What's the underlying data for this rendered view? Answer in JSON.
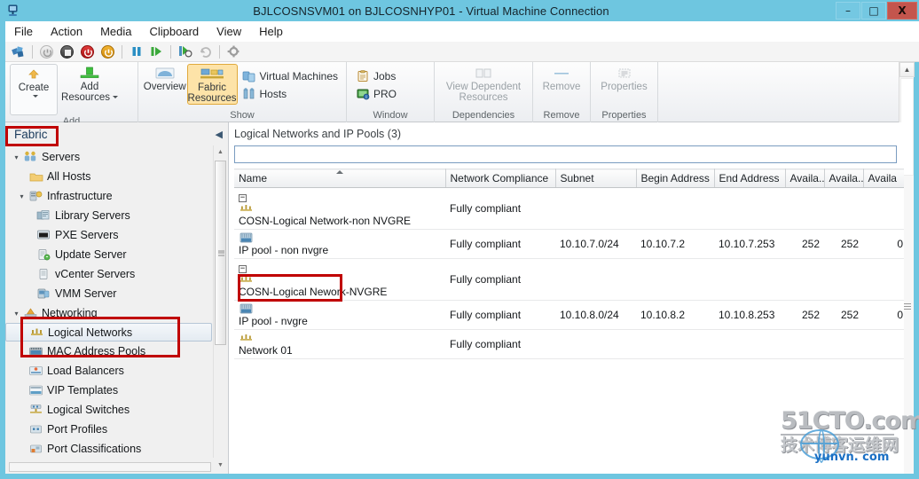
{
  "window": {
    "title": "BJLCOSNSVM01 on BJLCOSNHYP01 - Virtual Machine Connection",
    "app_icon": "virtual-machine-icon",
    "minimize": "–",
    "maximize": "□",
    "close": "X"
  },
  "menubar": {
    "items": [
      {
        "label": "File"
      },
      {
        "label": "Action"
      },
      {
        "label": "Media"
      },
      {
        "label": "Clipboard"
      },
      {
        "label": "View"
      },
      {
        "label": "Help"
      }
    ]
  },
  "vm_toolbar": {
    "buttons": [
      {
        "name": "ctrl-alt-delete-icon"
      },
      {
        "name": "start-icon"
      },
      {
        "name": "turn-off-icon"
      },
      {
        "name": "shut-down-icon"
      },
      {
        "name": "reset-icon"
      },
      {
        "name": "pause-icon"
      },
      {
        "name": "resume-icon"
      },
      {
        "name": "snapshot-icon"
      },
      {
        "name": "revert-icon"
      },
      {
        "name": "settings-icon"
      }
    ]
  },
  "ribbon": {
    "groups": [
      {
        "label": "Add",
        "buttons": [
          {
            "label_line1": "Create",
            "label_line2": "",
            "icon": "create-icon",
            "has_dropdown": true,
            "selected": false,
            "disabled": false
          },
          {
            "label_line1": "Add",
            "label_line2": "Resources",
            "icon": "add-resources-icon",
            "has_dropdown": true,
            "selected": false,
            "disabled": false
          }
        ]
      },
      {
        "label": "Show",
        "buttons": [
          {
            "label_line1": "Overview",
            "label_line2": "",
            "icon": "overview-icon",
            "has_dropdown": false,
            "selected": false,
            "disabled": false
          },
          {
            "label_line1": "Fabric",
            "label_line2": "Resources",
            "icon": "fabric-resources-icon",
            "has_dropdown": false,
            "selected": true,
            "disabled": false
          }
        ],
        "small_buttons": [
          {
            "label": "Virtual Machines",
            "icon": "virtual-machines-icon"
          },
          {
            "label": "Hosts",
            "icon": "hosts-icon"
          }
        ]
      },
      {
        "label": "Window",
        "small_buttons": [
          {
            "label": "Jobs",
            "icon": "jobs-icon"
          },
          {
            "label": "PRO",
            "icon": "pro-icon"
          }
        ]
      },
      {
        "label": "Dependencies",
        "buttons": [
          {
            "label_line1": "View Dependent",
            "label_line2": "Resources",
            "icon": "view-dependent-resources-icon",
            "has_dropdown": false,
            "selected": false,
            "disabled": true
          }
        ]
      },
      {
        "label": "Remove",
        "buttons": [
          {
            "label_line1": "Remove",
            "label_line2": "",
            "icon": "remove-icon",
            "has_dropdown": false,
            "selected": false,
            "disabled": true
          }
        ]
      },
      {
        "label": "Properties",
        "buttons": [
          {
            "label_line1": "Properties",
            "label_line2": "",
            "icon": "properties-icon",
            "has_dropdown": false,
            "selected": false,
            "disabled": true
          }
        ]
      }
    ]
  },
  "left_pane": {
    "title": "Fabric",
    "collapse_icon": "◀",
    "tree": [
      {
        "label": "Servers",
        "icon": "servers-icon",
        "depth": 0,
        "twisty": "expanded",
        "selected": false
      },
      {
        "label": "All Hosts",
        "icon": "folder-icon",
        "depth": 1,
        "twisty": "none",
        "selected": false
      },
      {
        "label": "Infrastructure",
        "icon": "infrastructure-icon",
        "depth": 1,
        "twisty": "expanded",
        "selected": false
      },
      {
        "label": "Library Servers",
        "icon": "library-servers-icon",
        "depth": 2,
        "twisty": "none",
        "selected": false
      },
      {
        "label": "PXE Servers",
        "icon": "pxe-servers-icon",
        "depth": 2,
        "twisty": "none",
        "selected": false
      },
      {
        "label": "Update Server",
        "icon": "update-server-icon",
        "depth": 2,
        "twisty": "none",
        "selected": false
      },
      {
        "label": "vCenter Servers",
        "icon": "vcenter-servers-icon",
        "depth": 2,
        "twisty": "none",
        "selected": false
      },
      {
        "label": "VMM Server",
        "icon": "vmm-server-icon",
        "depth": 2,
        "twisty": "none",
        "selected": false
      },
      {
        "label": "Networking",
        "icon": "networking-icon",
        "depth": 0,
        "twisty": "expanded",
        "selected": false
      },
      {
        "label": "Logical Networks",
        "icon": "logical-networks-icon",
        "depth": 1,
        "twisty": "none",
        "selected": true
      },
      {
        "label": "MAC Address Pools",
        "icon": "mac-address-pools-icon",
        "depth": 1,
        "twisty": "none",
        "selected": false
      },
      {
        "label": "Load Balancers",
        "icon": "load-balancers-icon",
        "depth": 1,
        "twisty": "none",
        "selected": false
      },
      {
        "label": "VIP Templates",
        "icon": "vip-templates-icon",
        "depth": 1,
        "twisty": "none",
        "selected": false
      },
      {
        "label": "Logical Switches",
        "icon": "logical-switches-icon",
        "depth": 1,
        "twisty": "none",
        "selected": false
      },
      {
        "label": "Port Profiles",
        "icon": "port-profiles-icon",
        "depth": 1,
        "twisty": "none",
        "selected": false
      },
      {
        "label": "Port Classifications",
        "icon": "port-classifications-icon",
        "depth": 1,
        "twisty": "none",
        "selected": false
      }
    ]
  },
  "content": {
    "title": "Logical Networks and IP Pools (3)",
    "filter_value": "",
    "columns": [
      {
        "label": "Name",
        "sorted": true
      },
      {
        "label": "Network Compliance",
        "sorted": false
      },
      {
        "label": "Subnet",
        "sorted": false
      },
      {
        "label": "Begin Address",
        "sorted": false
      },
      {
        "label": "End Address",
        "sorted": false
      },
      {
        "label": "Availa...",
        "sorted": false
      },
      {
        "label": "Availa...",
        "sorted": false
      },
      {
        "label": "Availa",
        "sorted": false
      }
    ],
    "rows": [
      {
        "name": "COSN-Logical Network-non NVGRE",
        "icon": "logical-network-icon",
        "level": 0,
        "expander": "−",
        "compliance": "Fully compliant",
        "subnet": "",
        "begin": "",
        "end": "",
        "a1": "",
        "a2": "",
        "a3": "",
        "highlighted": false
      },
      {
        "name": "IP pool - non nvgre",
        "icon": "ip-pool-icon",
        "level": 1,
        "expander": "",
        "compliance": "Fully compliant",
        "subnet": "10.10.7.0/24",
        "begin": "10.10.7.2",
        "end": "10.10.7.253",
        "a1": "252",
        "a2": "252",
        "a3": "0",
        "highlighted": false
      },
      {
        "name": "COSN-Logical Nework-NVGRE",
        "icon": "logical-network-icon",
        "level": 0,
        "expander": "−",
        "compliance": "Fully compliant",
        "subnet": "",
        "begin": "",
        "end": "",
        "a1": "",
        "a2": "",
        "a3": "",
        "highlighted": false
      },
      {
        "name": "IP pool - nvgre",
        "icon": "ip-pool-icon",
        "level": 1,
        "expander": "",
        "compliance": "Fully compliant",
        "subnet": "10.10.8.0/24",
        "begin": "10.10.8.2",
        "end": "10.10.8.253",
        "a1": "252",
        "a2": "252",
        "a3": "0",
        "highlighted": false
      },
      {
        "name": "Network 01",
        "icon": "logical-network-icon",
        "level": 0,
        "expander": "",
        "compliance": "Fully compliant",
        "subnet": "",
        "begin": "",
        "end": "",
        "a1": "",
        "a2": "",
        "a3": "",
        "highlighted": true
      }
    ]
  },
  "watermark": {
    "line1": "51CTO.com",
    "line2": "技术博客运维网",
    "url": "yunvn. com"
  },
  "annotations": {
    "highlight_color": "#c00000",
    "boxes": [
      {
        "name": "fabric-label-highlight"
      },
      {
        "name": "networking-tree-highlight"
      },
      {
        "name": "network-01-row-highlight"
      }
    ]
  },
  "colors": {
    "window_chrome": "#6ec6e0",
    "selected_ribbon_button": "#fde3a8",
    "accent_red": "#c00000"
  }
}
